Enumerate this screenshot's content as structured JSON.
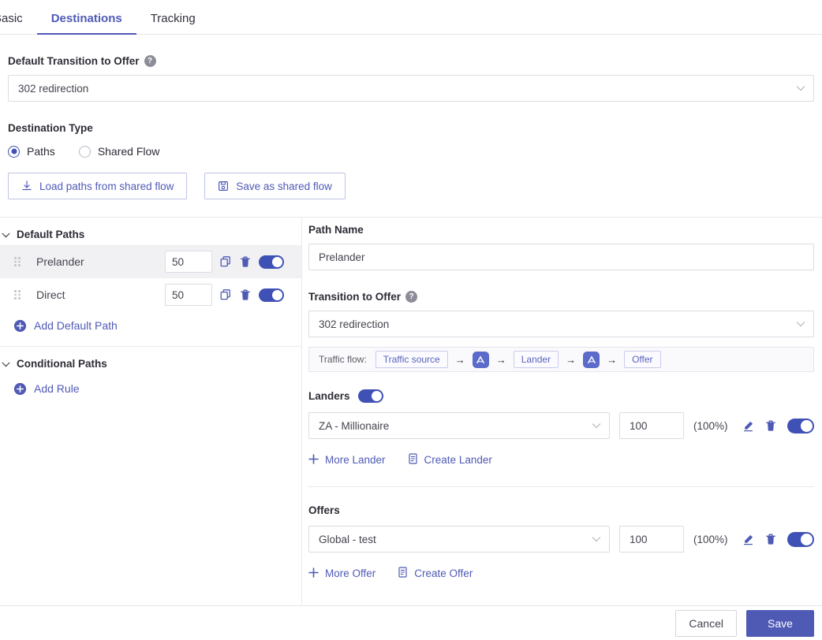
{
  "tabs": [
    {
      "label": "Basic",
      "active": false
    },
    {
      "label": "Destinations",
      "active": true
    },
    {
      "label": "Tracking",
      "active": false
    }
  ],
  "default_transition": {
    "label": "Default Transition to Offer",
    "help": "?",
    "value": "302 redirection"
  },
  "destination_type": {
    "label": "Destination Type",
    "options": [
      {
        "label": "Paths",
        "checked": true
      },
      {
        "label": "Shared Flow",
        "checked": false
      }
    ]
  },
  "shared_flow_buttons": {
    "load": "Load paths from shared flow",
    "save": "Save as shared flow"
  },
  "left_panel": {
    "default_paths": {
      "title": "Default Paths",
      "rows": [
        {
          "name": "Prelander",
          "weight": "50",
          "enabled": true,
          "selected": true
        },
        {
          "name": "Direct",
          "weight": "50",
          "enabled": true,
          "selected": false
        }
      ],
      "add_label": "Add Default Path"
    },
    "conditional_paths": {
      "title": "Conditional Paths",
      "add_label": "Add Rule"
    }
  },
  "right_panel": {
    "path_name": {
      "label": "Path Name",
      "value": "Prelander"
    },
    "transition": {
      "label": "Transition to Offer",
      "help": "?",
      "value": "302 redirection"
    },
    "traffic_flow": {
      "label": "Traffic flow:",
      "nodes": [
        "Traffic source",
        "Lander",
        "Offer"
      ],
      "arrow": "→"
    },
    "landers": {
      "label": "Landers",
      "enabled": true,
      "items": [
        {
          "name": "ZA - Millionaire",
          "weight": "100",
          "percent": "(100%)",
          "enabled": true
        }
      ],
      "more_label": "More Lander",
      "create_label": "Create Lander"
    },
    "offers": {
      "label": "Offers",
      "items": [
        {
          "name": "Global - test",
          "weight": "100",
          "percent": "(100%)",
          "enabled": true
        }
      ],
      "more_label": "More Offer",
      "create_label": "Create Offer"
    }
  },
  "footer": {
    "cancel": "Cancel",
    "save": "Save"
  },
  "colors": {
    "accent": "#4f5ab5",
    "toggle_on": "#3f51b5",
    "chip_border": "#c9cdec",
    "logo_bg": "#5c6bc9"
  }
}
